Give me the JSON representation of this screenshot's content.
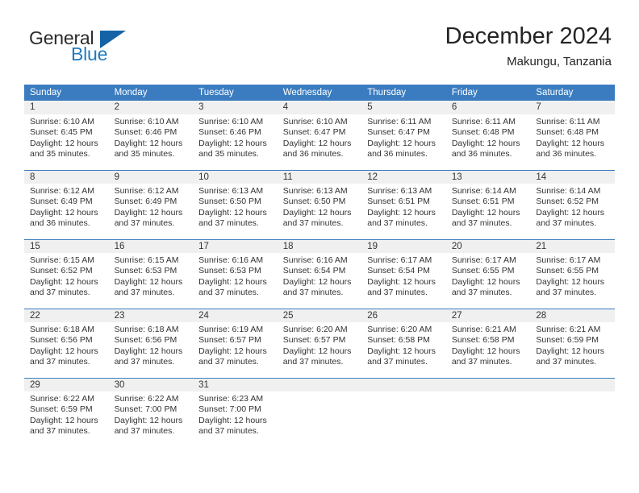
{
  "brand": {
    "name_part1": "General",
    "name_part2": "Blue",
    "logo_icon": "triangle-logo-icon",
    "colors": {
      "blue": "#1f7bc1",
      "triangle": "#1464a5",
      "dark": "#2b2b2b"
    }
  },
  "header": {
    "title": "December 2024",
    "subtitle": "Makungu, Tanzania"
  },
  "theme": {
    "header_bg": "#3b7cc0",
    "daynum_bg": "#f0f0f0",
    "cell_bg": "#ffffff",
    "text": "#333333"
  },
  "weekdays": [
    "Sunday",
    "Monday",
    "Tuesday",
    "Wednesday",
    "Thursday",
    "Friday",
    "Saturday"
  ],
  "weeks": [
    [
      {
        "day": "1",
        "sunrise": "Sunrise: 6:10 AM",
        "sunset": "Sunset: 6:45 PM",
        "daylight1": "Daylight: 12 hours",
        "daylight2": "and 35 minutes."
      },
      {
        "day": "2",
        "sunrise": "Sunrise: 6:10 AM",
        "sunset": "Sunset: 6:46 PM",
        "daylight1": "Daylight: 12 hours",
        "daylight2": "and 35 minutes."
      },
      {
        "day": "3",
        "sunrise": "Sunrise: 6:10 AM",
        "sunset": "Sunset: 6:46 PM",
        "daylight1": "Daylight: 12 hours",
        "daylight2": "and 35 minutes."
      },
      {
        "day": "4",
        "sunrise": "Sunrise: 6:10 AM",
        "sunset": "Sunset: 6:47 PM",
        "daylight1": "Daylight: 12 hours",
        "daylight2": "and 36 minutes."
      },
      {
        "day": "5",
        "sunrise": "Sunrise: 6:11 AM",
        "sunset": "Sunset: 6:47 PM",
        "daylight1": "Daylight: 12 hours",
        "daylight2": "and 36 minutes."
      },
      {
        "day": "6",
        "sunrise": "Sunrise: 6:11 AM",
        "sunset": "Sunset: 6:48 PM",
        "daylight1": "Daylight: 12 hours",
        "daylight2": "and 36 minutes."
      },
      {
        "day": "7",
        "sunrise": "Sunrise: 6:11 AM",
        "sunset": "Sunset: 6:48 PM",
        "daylight1": "Daylight: 12 hours",
        "daylight2": "and 36 minutes."
      }
    ],
    [
      {
        "day": "8",
        "sunrise": "Sunrise: 6:12 AM",
        "sunset": "Sunset: 6:49 PM",
        "daylight1": "Daylight: 12 hours",
        "daylight2": "and 36 minutes."
      },
      {
        "day": "9",
        "sunrise": "Sunrise: 6:12 AM",
        "sunset": "Sunset: 6:49 PM",
        "daylight1": "Daylight: 12 hours",
        "daylight2": "and 37 minutes."
      },
      {
        "day": "10",
        "sunrise": "Sunrise: 6:13 AM",
        "sunset": "Sunset: 6:50 PM",
        "daylight1": "Daylight: 12 hours",
        "daylight2": "and 37 minutes."
      },
      {
        "day": "11",
        "sunrise": "Sunrise: 6:13 AM",
        "sunset": "Sunset: 6:50 PM",
        "daylight1": "Daylight: 12 hours",
        "daylight2": "and 37 minutes."
      },
      {
        "day": "12",
        "sunrise": "Sunrise: 6:13 AM",
        "sunset": "Sunset: 6:51 PM",
        "daylight1": "Daylight: 12 hours",
        "daylight2": "and 37 minutes."
      },
      {
        "day": "13",
        "sunrise": "Sunrise: 6:14 AM",
        "sunset": "Sunset: 6:51 PM",
        "daylight1": "Daylight: 12 hours",
        "daylight2": "and 37 minutes."
      },
      {
        "day": "14",
        "sunrise": "Sunrise: 6:14 AM",
        "sunset": "Sunset: 6:52 PM",
        "daylight1": "Daylight: 12 hours",
        "daylight2": "and 37 minutes."
      }
    ],
    [
      {
        "day": "15",
        "sunrise": "Sunrise: 6:15 AM",
        "sunset": "Sunset: 6:52 PM",
        "daylight1": "Daylight: 12 hours",
        "daylight2": "and 37 minutes."
      },
      {
        "day": "16",
        "sunrise": "Sunrise: 6:15 AM",
        "sunset": "Sunset: 6:53 PM",
        "daylight1": "Daylight: 12 hours",
        "daylight2": "and 37 minutes."
      },
      {
        "day": "17",
        "sunrise": "Sunrise: 6:16 AM",
        "sunset": "Sunset: 6:53 PM",
        "daylight1": "Daylight: 12 hours",
        "daylight2": "and 37 minutes."
      },
      {
        "day": "18",
        "sunrise": "Sunrise: 6:16 AM",
        "sunset": "Sunset: 6:54 PM",
        "daylight1": "Daylight: 12 hours",
        "daylight2": "and 37 minutes."
      },
      {
        "day": "19",
        "sunrise": "Sunrise: 6:17 AM",
        "sunset": "Sunset: 6:54 PM",
        "daylight1": "Daylight: 12 hours",
        "daylight2": "and 37 minutes."
      },
      {
        "day": "20",
        "sunrise": "Sunrise: 6:17 AM",
        "sunset": "Sunset: 6:55 PM",
        "daylight1": "Daylight: 12 hours",
        "daylight2": "and 37 minutes."
      },
      {
        "day": "21",
        "sunrise": "Sunrise: 6:17 AM",
        "sunset": "Sunset: 6:55 PM",
        "daylight1": "Daylight: 12 hours",
        "daylight2": "and 37 minutes."
      }
    ],
    [
      {
        "day": "22",
        "sunrise": "Sunrise: 6:18 AM",
        "sunset": "Sunset: 6:56 PM",
        "daylight1": "Daylight: 12 hours",
        "daylight2": "and 37 minutes."
      },
      {
        "day": "23",
        "sunrise": "Sunrise: 6:18 AM",
        "sunset": "Sunset: 6:56 PM",
        "daylight1": "Daylight: 12 hours",
        "daylight2": "and 37 minutes."
      },
      {
        "day": "24",
        "sunrise": "Sunrise: 6:19 AM",
        "sunset": "Sunset: 6:57 PM",
        "daylight1": "Daylight: 12 hours",
        "daylight2": "and 37 minutes."
      },
      {
        "day": "25",
        "sunrise": "Sunrise: 6:20 AM",
        "sunset": "Sunset: 6:57 PM",
        "daylight1": "Daylight: 12 hours",
        "daylight2": "and 37 minutes."
      },
      {
        "day": "26",
        "sunrise": "Sunrise: 6:20 AM",
        "sunset": "Sunset: 6:58 PM",
        "daylight1": "Daylight: 12 hours",
        "daylight2": "and 37 minutes."
      },
      {
        "day": "27",
        "sunrise": "Sunrise: 6:21 AM",
        "sunset": "Sunset: 6:58 PM",
        "daylight1": "Daylight: 12 hours",
        "daylight2": "and 37 minutes."
      },
      {
        "day": "28",
        "sunrise": "Sunrise: 6:21 AM",
        "sunset": "Sunset: 6:59 PM",
        "daylight1": "Daylight: 12 hours",
        "daylight2": "and 37 minutes."
      }
    ],
    [
      {
        "day": "29",
        "sunrise": "Sunrise: 6:22 AM",
        "sunset": "Sunset: 6:59 PM",
        "daylight1": "Daylight: 12 hours",
        "daylight2": "and 37 minutes."
      },
      {
        "day": "30",
        "sunrise": "Sunrise: 6:22 AM",
        "sunset": "Sunset: 7:00 PM",
        "daylight1": "Daylight: 12 hours",
        "daylight2": "and 37 minutes."
      },
      {
        "day": "31",
        "sunrise": "Sunrise: 6:23 AM",
        "sunset": "Sunset: 7:00 PM",
        "daylight1": "Daylight: 12 hours",
        "daylight2": "and 37 minutes."
      },
      {
        "day": "",
        "sunrise": "",
        "sunset": "",
        "daylight1": "",
        "daylight2": ""
      },
      {
        "day": "",
        "sunrise": "",
        "sunset": "",
        "daylight1": "",
        "daylight2": ""
      },
      {
        "day": "",
        "sunrise": "",
        "sunset": "",
        "daylight1": "",
        "daylight2": ""
      },
      {
        "day": "",
        "sunrise": "",
        "sunset": "",
        "daylight1": "",
        "daylight2": ""
      }
    ]
  ]
}
